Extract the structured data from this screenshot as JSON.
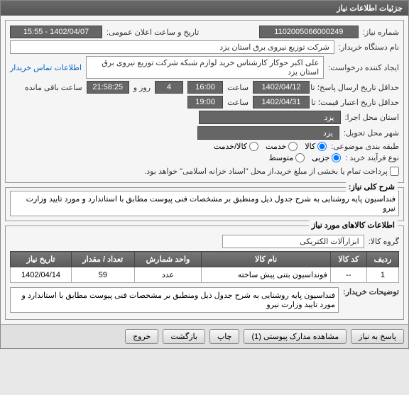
{
  "panel_title": "جزئیات اطلاعات نیاز",
  "f1": {
    "need_no_label": "شماره نیاز:",
    "need_no": "1102005066000249",
    "public_date_label": "تاریخ و ساعت اعلان عمومی:",
    "public_date": "1402/04/07 - 15:55",
    "org_label": "نام دستگاه خریدار:",
    "org": "شرکت توزیع نیروی برق استان یزد",
    "creator_label": "ایجاد کننده درخواست:",
    "creator": "علی اکبر حوکار  کارشناس خرید لوازم شبکه  شرکت توزیع نیروی برق استان یزد",
    "contact_link": "اطلاعات تماس خریدار",
    "deadline_label": "حداقل تاریخ ارسال پاسخ؛ تا تاریخ:",
    "deadline_date": "1402/04/12",
    "time_label": "ساعت",
    "deadline_time": "16:00",
    "deadline_days": "4",
    "remaining_time": "21:58:25",
    "remaining_label": "ساعت باقی مانده",
    "validity_label": "حداقل تاریخ اعتبار قیمت؛ تا تاریخ:",
    "validity_date": "1402/04/31",
    "validity_time": "19:00",
    "exec_city_label": "استان محل اجرا:",
    "exec_city": "یزد",
    "delivery_city_label": "شهر محل تحویل:",
    "delivery_city": "یزد",
    "category_label": "طبقه بندی موضوعی:",
    "cat_goods": "کالا",
    "cat_service": "خدمت",
    "cat_goods_service": "کالا/خدمت",
    "process_label": "نوع فرآیند خرید :",
    "proc_small": "جزیی",
    "proc_medium": "متوسط",
    "payment_note": "پرداخت تمام یا بخشی از مبلغ خرید،از محل \"اسناد خزانه اسلامی\" خواهد بود."
  },
  "f2": {
    "legend": "شرح کلی نیاز:",
    "text": "فنداسیون پایه روشنایی به شرح جدول ذیل ومنطبق بر  مشخصات فنی پیوست مطابق با استاندارد و مورد تایید وزارت نیرو"
  },
  "f3": {
    "legend": "اطلاعات کالاهای مورد نیاز",
    "group_label": "گروه کالا:",
    "group": "ابزارآلات الکتریکی",
    "cols": {
      "row": "ردیف",
      "code": "کد کالا",
      "name": "نام کالا",
      "unit": "واحد شمارش",
      "qty": "تعداد / مقدار",
      "date": "تاریخ نیاز"
    },
    "rows": [
      {
        "row": "1",
        "code": "--",
        "name": "فونداسیون بتنی پیش ساخته",
        "unit": "عدد",
        "qty": "59",
        "date": "1402/04/14"
      }
    ],
    "buyer_note_label": "توضیحات خریدار:",
    "buyer_note": "فنداسیون پایه روشنایی به شرح جدول ذیل ومنطبق بر  مشخصات فنی پیوست مطابق با استاندارد و مورد تایید وزارت نیرو"
  },
  "buttons": {
    "respond": "پاسخ به نیاز",
    "attachments": "مشاهده مدارک پیوستی (1)",
    "print": "چاپ",
    "back": "بازگشت",
    "exit": "خروج"
  }
}
